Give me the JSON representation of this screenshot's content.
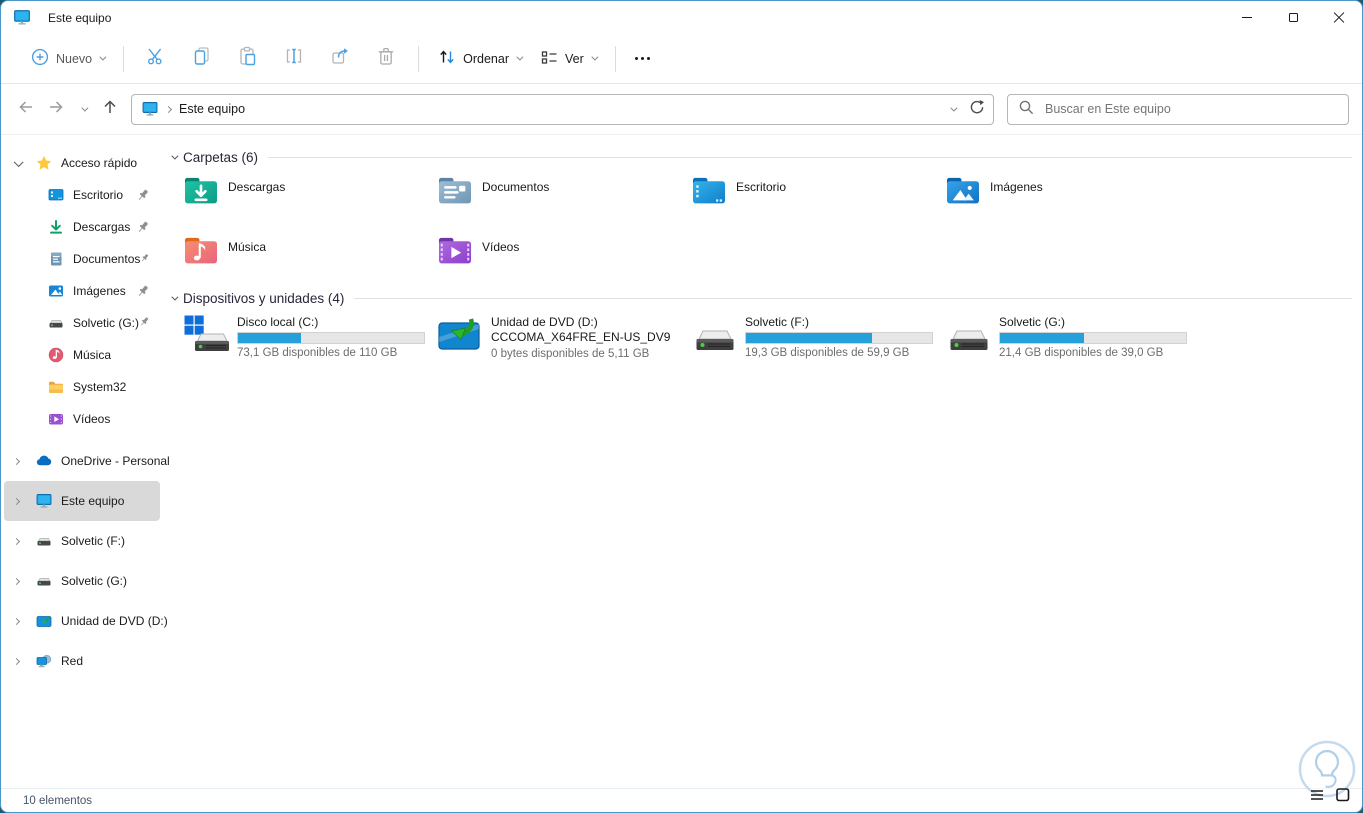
{
  "window": {
    "title": "Este equipo"
  },
  "toolbar": {
    "new_label": "Nuevo",
    "sort_label": "Ordenar",
    "view_label": "Ver"
  },
  "addressbar": {
    "breadcrumb": "Este equipo",
    "search_placeholder": "Buscar en Este equipo"
  },
  "sidebar": {
    "quick_access_label": "Acceso rápido",
    "quick_items": [
      {
        "label": "Escritorio",
        "icon": "desktop-icon",
        "pinned": true
      },
      {
        "label": "Descargas",
        "icon": "downloads-icon",
        "pinned": true
      },
      {
        "label": "Documentos",
        "icon": "documents-icon",
        "pinned": true
      },
      {
        "label": "Imágenes",
        "icon": "pictures-icon",
        "pinned": true
      },
      {
        "label": "Solvetic (G:)",
        "icon": "drive-icon",
        "pinned": true
      },
      {
        "label": "Música",
        "icon": "music-icon",
        "pinned": false
      },
      {
        "label": "System32",
        "icon": "folder-icon",
        "pinned": false
      },
      {
        "label": "Vídeos",
        "icon": "videos-icon",
        "pinned": false
      }
    ],
    "tree_items": [
      {
        "label": "OneDrive - Personal",
        "icon": "onedrive-icon",
        "selected": false
      },
      {
        "label": "Este equipo",
        "icon": "this-pc-icon",
        "selected": true
      },
      {
        "label": "Solvetic (F:)",
        "icon": "drive-icon",
        "selected": false
      },
      {
        "label": "Solvetic (G:)",
        "icon": "drive-icon",
        "selected": false
      },
      {
        "label": "Unidad de DVD (D:)",
        "icon": "dvd-icon",
        "selected": false
      },
      {
        "label": "Red",
        "icon": "network-icon",
        "selected": false
      }
    ]
  },
  "content": {
    "folders_header": "Carpetas (6)",
    "folders": [
      {
        "name": "Descargas",
        "icon": "downloads-folder-icon"
      },
      {
        "name": "Documentos",
        "icon": "documents-folder-icon"
      },
      {
        "name": "Escritorio",
        "icon": "desktop-folder-icon"
      },
      {
        "name": "Imágenes",
        "icon": "pictures-folder-icon"
      },
      {
        "name": "Música",
        "icon": "music-folder-icon"
      },
      {
        "name": "Vídeos",
        "icon": "videos-folder-icon"
      }
    ],
    "devices_header": "Dispositivos y unidades (4)",
    "drives": [
      {
        "name": "Disco local (C:)",
        "free": "73,1 GB disponibles de 110 GB",
        "used_percent": 34,
        "icon": "system-drive-icon"
      },
      {
        "name": "Unidad de DVD (D:)",
        "volume": "CCCOMA_X64FRE_EN-US_DV9",
        "free": "0 bytes disponibles de 5,11 GB",
        "icon": "dvd-drive-icon"
      },
      {
        "name": "Solvetic (F:)",
        "free": "19,3 GB disponibles de 59,9 GB",
        "used_percent": 68,
        "icon": "drive-icon"
      },
      {
        "name": "Solvetic (G:)",
        "free": "21,4 GB disponibles de 39,0 GB",
        "used_percent": 45,
        "icon": "drive-icon"
      }
    ]
  },
  "statusbar": {
    "items_count": "10 elementos"
  },
  "colors": {
    "accent": "#0078d4",
    "progress_fill": "#26a0da",
    "selection_bg": "#d9d9d9",
    "backdrop": "#1f5971"
  }
}
